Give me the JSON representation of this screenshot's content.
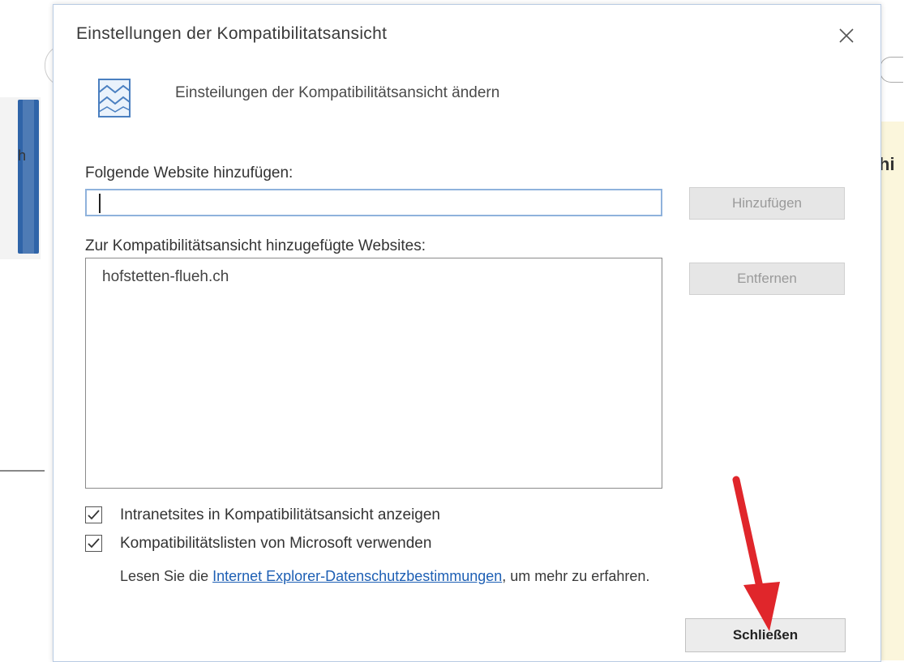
{
  "background": {
    "left_fragment": "h",
    "right_fragment": "hi"
  },
  "dialog": {
    "title": "Einstellungen der Kompatibilitatsansicht",
    "header_text": "Einsteilungen der Kompatibilitätsansicht ändern",
    "add_label": "Folgende Website hinzufügen:",
    "add_input_value": "",
    "add_button": "Hinzufügen",
    "list_label": "Zur Kompatibilitätsansicht hinzugefügte Websites:",
    "sites": [
      "hofstetten-flueh.ch"
    ],
    "remove_button": "Entfernen",
    "checkbox_intranet": {
      "label": "Intranetsites in Kompatibilitätsansicht anzeigen",
      "checked": true
    },
    "checkbox_microsoft": {
      "label": "Kompatibilitätslisten von Microsoft verwenden",
      "checked": true
    },
    "privacy_prefix": "Lesen Sie die ",
    "privacy_link": "Internet Explorer-Datenschutzbestimmungen",
    "privacy_suffix": ", um mehr zu erfahren.",
    "close_button": "Schließen"
  },
  "colors": {
    "annotation_arrow": "#e0262b",
    "link": "#1d5fb4",
    "input_border": "#8fb2dc"
  }
}
